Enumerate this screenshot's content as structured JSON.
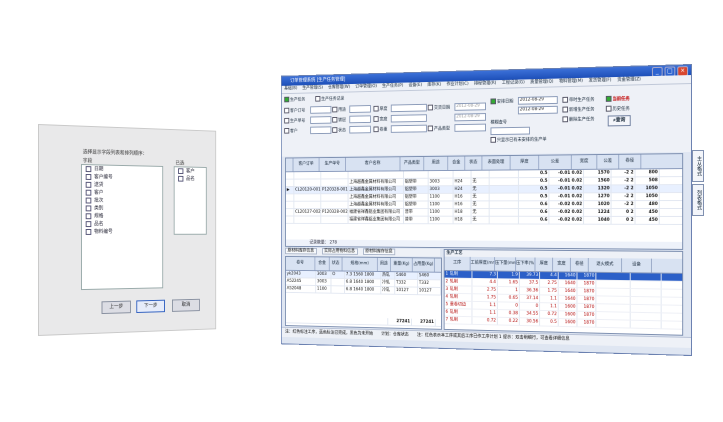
{
  "wizard": {
    "prompt": "选择显示字段列表和排列顺序：",
    "left_title": "字段",
    "left_fields": [
      "日期",
      "客户编号",
      "送货",
      "客户",
      "批次",
      "类别",
      "规格",
      "品名",
      "物料编号"
    ],
    "right_title": "已选",
    "right_fields": [
      "客户",
      "品名"
    ],
    "btn_prev": "上一步",
    "btn_next": "下一步",
    "btn_cancel": "取消"
  },
  "window": {
    "title": "订单管理系统  [生产任务管理]",
    "min": "_",
    "max": "□",
    "close": "×"
  },
  "menu": [
    "基础(B)",
    "生产管理(S)",
    "仓库管理(W)",
    "订单管理(O)",
    "生产任务(P)",
    "设备(E)",
    "库存(K)",
    "作业计划(C)",
    "排程管理(R)",
    "工程记录(G)",
    "质量管理(Q)",
    "物料管理(M)",
    "发货管理(F)",
    "资金管理(Z)"
  ],
  "filters": {
    "tab1": "生产任务",
    "tab2": "生产任务记录",
    "customer_code": "客户订号",
    "production_no": "生产单号",
    "customer": "客户",
    "product_type": "用途",
    "coating": "镀层",
    "status": "状态",
    "thickness": "厚度",
    "width": "宽度",
    "volume": "卷重",
    "delivery_date": "交货日期",
    "date_from": "2012-08-29",
    "date_to": "2012-08-29",
    "schedule_date": "安排日期",
    "schedule_from": "2012-08-29",
    "schedule_to": "2012-08-29",
    "product_kind": "产品类型",
    "model_no": "模糊查号",
    "only_unfinished": "只显示已有未安排的生产单",
    "chk_has_task": "带时生产任务",
    "chk_new_task": "新增生产任务",
    "chk_curr_task": "当前任务",
    "chk_hist_task": "历史任务",
    "chk_del_task": "删除生产任务",
    "search": "查询"
  },
  "grid": {
    "headers": [
      "",
      "客户订单",
      "生产单号",
      "客户名称",
      "产品类型",
      "用途",
      "合金",
      "状态",
      "表面处理",
      "厚度",
      "公差",
      "宽度",
      "公差",
      "卷径"
    ],
    "rows": [
      [
        "",
        "",
        "",
        "",
        "",
        "",
        "",
        "",
        "",
        "0.5",
        "-0.01 0.02",
        "1570",
        "-2 2",
        "800"
      ],
      [
        "",
        "",
        "",
        "上海越鑫金属材料有限公司",
        "铝塑带",
        "3003",
        "H24",
        "无",
        "",
        "0.5",
        "-0.01 0.02",
        "1560",
        "-2 2",
        "508"
      ],
      [
        "▶",
        "CL20120-001",
        "P120328-001",
        "上海越鑫金属材料有限公司",
        "铝塑带",
        "3003",
        "H24",
        "无",
        "",
        "0.5",
        "-0.01 0.02",
        "1320",
        "-2 2",
        "1050"
      ],
      [
        "",
        "",
        "",
        "上海越鑫金属材料有限公司",
        "铝塑带",
        "1100",
        "H16",
        "无",
        "",
        "0.5",
        "-0.01 0.02",
        "1270",
        "-2 2",
        "1050"
      ],
      [
        "",
        "",
        "",
        "上海越鑫金属材料有限公司",
        "铝塑带",
        "1100",
        "H16",
        "无",
        "",
        "0.6",
        "-0.02 0.02",
        "1020",
        "-2 2",
        "480"
      ],
      [
        "",
        "CL20127-002",
        "P120328-002",
        "福建省祥鑫铝业集团有限公司",
        "普带",
        "1100",
        "H18",
        "无",
        "",
        "0.6",
        "-0.02 0.02",
        "1224",
        "0 2",
        "450"
      ],
      [
        "",
        "",
        "",
        "福建省祥鑫铝业集团有限公司",
        "普带",
        "1100",
        "H18",
        "无",
        "",
        "0.6",
        "-0.02 0.02",
        "1040",
        "0 2",
        "450"
      ]
    ],
    "total": "记录数量：  278"
  },
  "lpanel": {
    "tabs": [
      "原材料库存信息",
      "实际占用物料信息",
      "原材料库存信息"
    ],
    "headers": [
      "卷号",
      "合金",
      "状态",
      "规格(mm)",
      "用途",
      "重量(Kg)",
      "占用量(Kg)"
    ],
    "rows": [
      [
        "yk2043",
        "3003",
        "O",
        "7.3 1560 1800",
        "热轧",
        "5460",
        "5460"
      ],
      [
        "A52245",
        "3003",
        "",
        "6.8 1640 1800",
        "冷轧",
        "T332",
        "T332"
      ],
      [
        "A52048",
        "1100",
        "",
        "6.8 1640 1800",
        "冷轧",
        "10127",
        "10127"
      ]
    ],
    "sum": [
      "27241",
      "27241"
    ]
  },
  "rpanel": {
    "title": "生产工艺",
    "headers": [
      "工序",
      "工前厚度(mm)",
      "压下量(mm)",
      "压下率(%)",
      "厚度",
      "宽度",
      "卷径",
      "退火模式",
      "设备"
    ],
    "rows": [
      [
        "1",
        "轧制",
        "7.3",
        "1.9",
        "39.73",
        "4.4",
        "1640",
        "1870",
        "",
        ""
      ],
      [
        "2",
        "轧制",
        "4.4",
        "1.65",
        "37.5",
        "2.75",
        "1640",
        "1870",
        "",
        ""
      ],
      [
        "3",
        "轧制",
        "2.75",
        "1",
        "36.36",
        "1.75",
        "1640",
        "1870",
        "",
        ""
      ],
      [
        "4",
        "轧制",
        "1.75",
        "0.65",
        "37.14",
        "1.1",
        "1640",
        "1870",
        "",
        ""
      ],
      [
        "5",
        "重卷切边",
        "1.1",
        "0",
        "0",
        "1.1",
        "1600",
        "1870",
        "",
        ""
      ],
      [
        "6",
        "轧制",
        "1.1",
        "0.38",
        "34.55",
        "0.72",
        "1600",
        "1870",
        "",
        ""
      ],
      [
        "7",
        "轧制",
        "0.72",
        "0.22",
        "30.56",
        "0.5",
        "1600",
        "1870",
        "",
        ""
      ]
    ]
  },
  "status": {
    "left": "注：红色标注工序，蓝色标注已完成，黑色为未开始",
    "mid": "计划：仓库状态",
    "right": "注：红色表示本工序或其后工序已作工序计划   1 提示：双击明细行，可查看详细信息"
  },
  "vtabs": [
    "主从格式",
    "列表格式"
  ]
}
